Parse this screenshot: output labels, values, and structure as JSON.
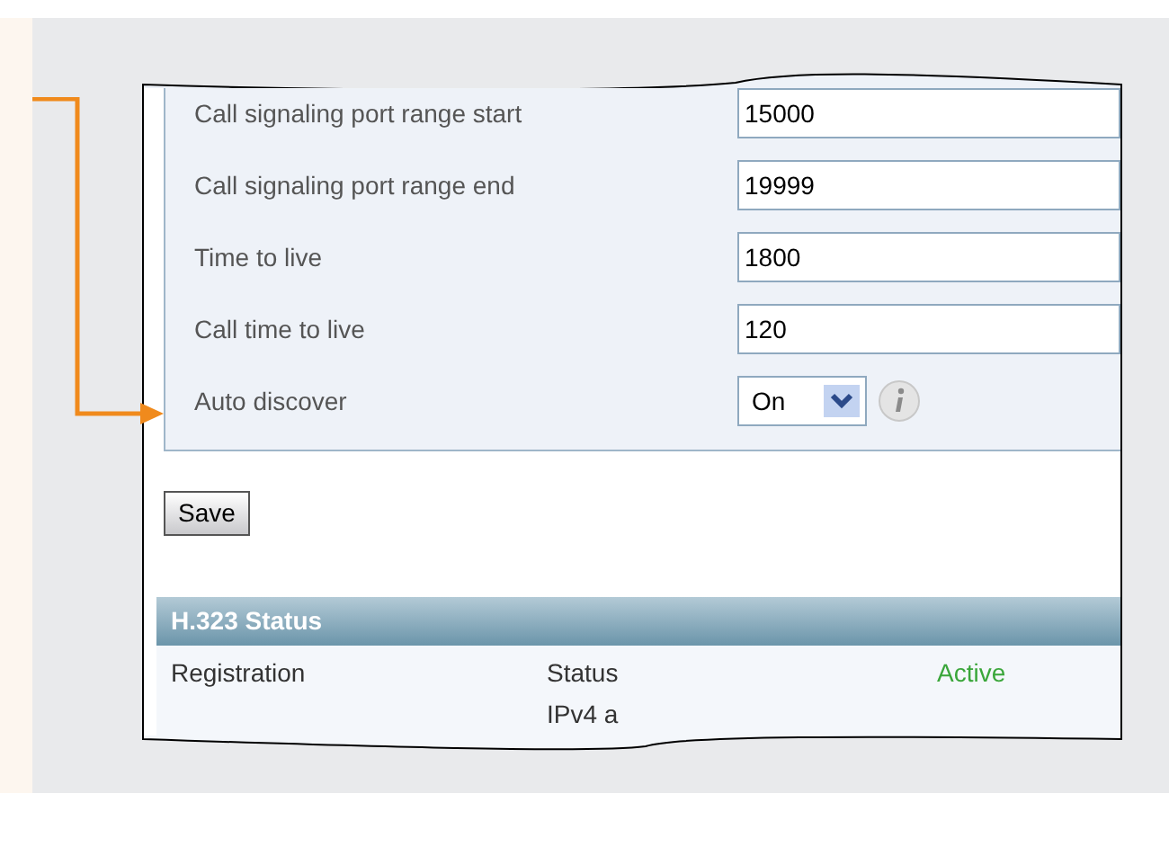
{
  "form": {
    "fields": [
      {
        "kind": "text",
        "label": "Call signaling port range start",
        "value": "15000"
      },
      {
        "kind": "text",
        "label": "Call signaling port range end",
        "value": "19999"
      },
      {
        "kind": "text",
        "label": "Time to live",
        "value": "1800"
      },
      {
        "kind": "text",
        "label": "Call time to live",
        "value": "120"
      },
      {
        "kind": "select",
        "label": "Auto discover",
        "value": "On"
      }
    ]
  },
  "save_button": "Save",
  "status_panel": {
    "title": "H.323 Status",
    "rows": [
      {
        "column_1": "Registration",
        "column_2": "Status",
        "column_3": "Active"
      },
      {
        "column_2": "IPv4 a"
      }
    ]
  }
}
